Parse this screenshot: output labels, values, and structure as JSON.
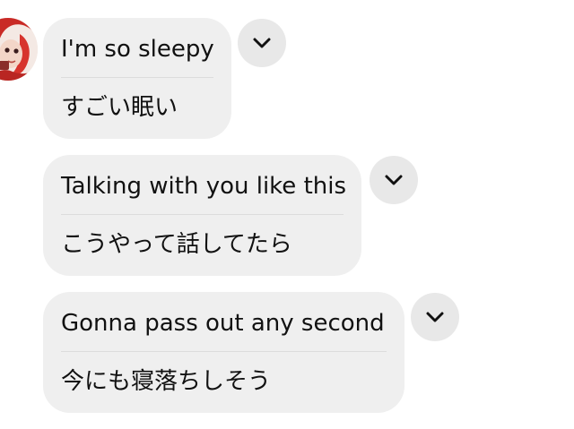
{
  "messages": [
    {
      "original": "I'm so sleepy",
      "translation": "すごい眠い"
    },
    {
      "original": "Talking with you like this",
      "translation": "こうやって話してたら"
    },
    {
      "original": "Gonna pass out any second",
      "translation": "今にも寝落ちしそう"
    }
  ],
  "icons": {
    "more": "chevron-down-icon",
    "avatar": "avatar"
  },
  "colors": {
    "bubble": "#efefef",
    "more_button": "#e8e8e8",
    "text": "#111111"
  }
}
